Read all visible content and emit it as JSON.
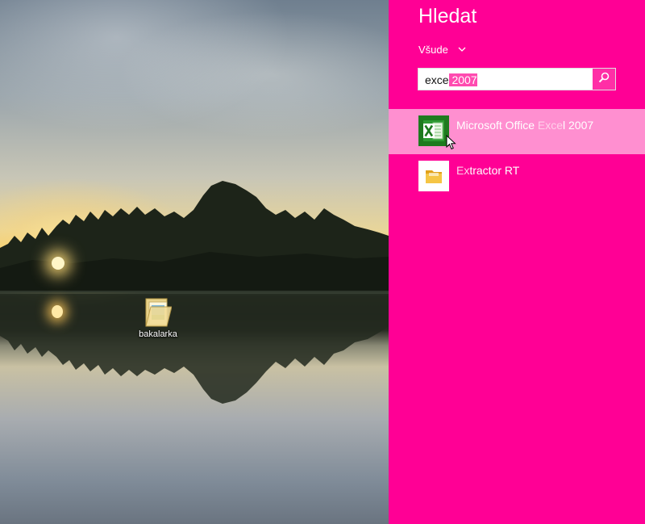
{
  "desktop": {
    "icons": [
      {
        "label": "bakalarka",
        "icon": "folder-icon"
      }
    ]
  },
  "charm": {
    "title": "Hledat",
    "scope_label": "Všude",
    "search": {
      "typed": "exce",
      "autocomplete": " 2007",
      "button_icon": "search-icon"
    },
    "results": [
      {
        "prefix": "Microsoft Office ",
        "match": "Exce",
        "suffix": "l 2007",
        "icon": "excel-icon"
      },
      {
        "prefix": "",
        "match": "Ex",
        "suffix": "tractor RT",
        "icon": "folder-icon"
      }
    ]
  },
  "colors": {
    "accent": "#ff0095",
    "hover": "#ff8fd0",
    "excel_green": "#1e7a1e"
  }
}
